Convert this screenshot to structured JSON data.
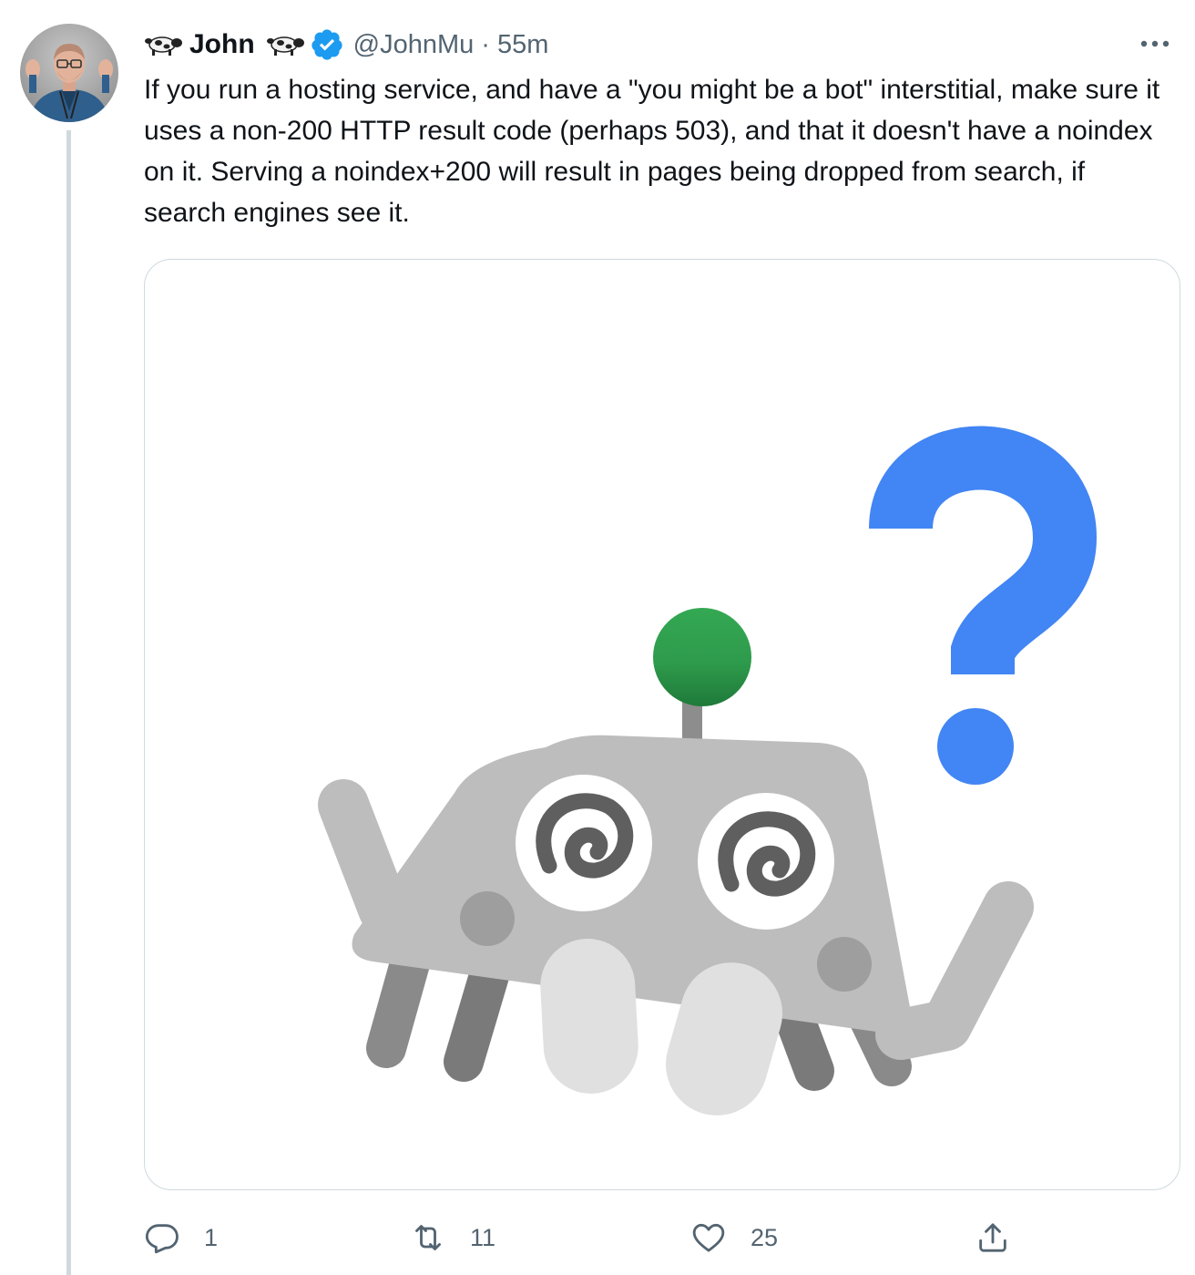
{
  "author": {
    "display_name": "John",
    "handle": "@JohnMu",
    "separator": "·",
    "timestamp": "55m",
    "name_prefix_icon": "cow-icon",
    "name_suffix_icon": "cow-icon",
    "verified_icon": "verified-badge-icon",
    "verified_color": "#1d9bf0"
  },
  "menu": {
    "icon": "more-icon"
  },
  "tweet": {
    "text": "If you run a hosting service, and have a \"you might be a bot\" interstitial, make sure it uses a non-200 HTTP result code (perhaps 503), and that it doesn't have a noindex on it. Serving a noindex+200 will result in pages being dropped from search, if search engines see it."
  },
  "media": {
    "illustration": "confused-robot-illustration",
    "accent_blue": "#4285f4",
    "accent_green": "#34a853"
  },
  "actions": {
    "reply": {
      "icon": "reply-icon",
      "count": "1"
    },
    "retweet": {
      "icon": "retweet-icon",
      "count": "11"
    },
    "like": {
      "icon": "heart-icon",
      "count": "25"
    },
    "share": {
      "icon": "share-icon"
    }
  },
  "colors": {
    "text_primary": "#0f1419",
    "text_secondary": "#536471",
    "border": "#cfd9de"
  }
}
